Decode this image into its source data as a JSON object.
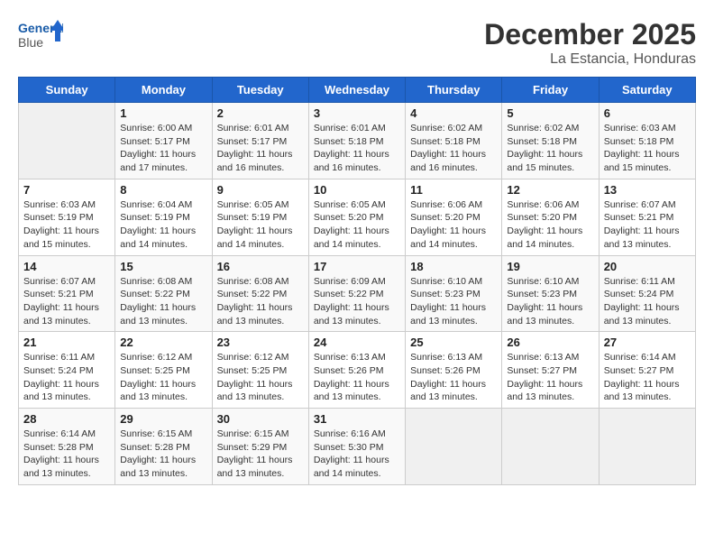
{
  "logo": {
    "name_part1": "General",
    "name_part2": "Blue"
  },
  "title": "December 2025",
  "location": "La Estancia, Honduras",
  "days_of_week": [
    "Sunday",
    "Monday",
    "Tuesday",
    "Wednesday",
    "Thursday",
    "Friday",
    "Saturday"
  ],
  "weeks": [
    [
      {
        "day": "",
        "empty": true
      },
      {
        "day": "1",
        "sunrise": "Sunrise: 6:00 AM",
        "sunset": "Sunset: 5:17 PM",
        "daylight": "Daylight: 11 hours and 17 minutes."
      },
      {
        "day": "2",
        "sunrise": "Sunrise: 6:01 AM",
        "sunset": "Sunset: 5:17 PM",
        "daylight": "Daylight: 11 hours and 16 minutes."
      },
      {
        "day": "3",
        "sunrise": "Sunrise: 6:01 AM",
        "sunset": "Sunset: 5:18 PM",
        "daylight": "Daylight: 11 hours and 16 minutes."
      },
      {
        "day": "4",
        "sunrise": "Sunrise: 6:02 AM",
        "sunset": "Sunset: 5:18 PM",
        "daylight": "Daylight: 11 hours and 16 minutes."
      },
      {
        "day": "5",
        "sunrise": "Sunrise: 6:02 AM",
        "sunset": "Sunset: 5:18 PM",
        "daylight": "Daylight: 11 hours and 15 minutes."
      },
      {
        "day": "6",
        "sunrise": "Sunrise: 6:03 AM",
        "sunset": "Sunset: 5:18 PM",
        "daylight": "Daylight: 11 hours and 15 minutes."
      }
    ],
    [
      {
        "day": "7",
        "sunrise": "Sunrise: 6:03 AM",
        "sunset": "Sunset: 5:19 PM",
        "daylight": "Daylight: 11 hours and 15 minutes."
      },
      {
        "day": "8",
        "sunrise": "Sunrise: 6:04 AM",
        "sunset": "Sunset: 5:19 PM",
        "daylight": "Daylight: 11 hours and 14 minutes."
      },
      {
        "day": "9",
        "sunrise": "Sunrise: 6:05 AM",
        "sunset": "Sunset: 5:19 PM",
        "daylight": "Daylight: 11 hours and 14 minutes."
      },
      {
        "day": "10",
        "sunrise": "Sunrise: 6:05 AM",
        "sunset": "Sunset: 5:20 PM",
        "daylight": "Daylight: 11 hours and 14 minutes."
      },
      {
        "day": "11",
        "sunrise": "Sunrise: 6:06 AM",
        "sunset": "Sunset: 5:20 PM",
        "daylight": "Daylight: 11 hours and 14 minutes."
      },
      {
        "day": "12",
        "sunrise": "Sunrise: 6:06 AM",
        "sunset": "Sunset: 5:20 PM",
        "daylight": "Daylight: 11 hours and 14 minutes."
      },
      {
        "day": "13",
        "sunrise": "Sunrise: 6:07 AM",
        "sunset": "Sunset: 5:21 PM",
        "daylight": "Daylight: 11 hours and 13 minutes."
      }
    ],
    [
      {
        "day": "14",
        "sunrise": "Sunrise: 6:07 AM",
        "sunset": "Sunset: 5:21 PM",
        "daylight": "Daylight: 11 hours and 13 minutes."
      },
      {
        "day": "15",
        "sunrise": "Sunrise: 6:08 AM",
        "sunset": "Sunset: 5:22 PM",
        "daylight": "Daylight: 11 hours and 13 minutes."
      },
      {
        "day": "16",
        "sunrise": "Sunrise: 6:08 AM",
        "sunset": "Sunset: 5:22 PM",
        "daylight": "Daylight: 11 hours and 13 minutes."
      },
      {
        "day": "17",
        "sunrise": "Sunrise: 6:09 AM",
        "sunset": "Sunset: 5:22 PM",
        "daylight": "Daylight: 11 hours and 13 minutes."
      },
      {
        "day": "18",
        "sunrise": "Sunrise: 6:10 AM",
        "sunset": "Sunset: 5:23 PM",
        "daylight": "Daylight: 11 hours and 13 minutes."
      },
      {
        "day": "19",
        "sunrise": "Sunrise: 6:10 AM",
        "sunset": "Sunset: 5:23 PM",
        "daylight": "Daylight: 11 hours and 13 minutes."
      },
      {
        "day": "20",
        "sunrise": "Sunrise: 6:11 AM",
        "sunset": "Sunset: 5:24 PM",
        "daylight": "Daylight: 11 hours and 13 minutes."
      }
    ],
    [
      {
        "day": "21",
        "sunrise": "Sunrise: 6:11 AM",
        "sunset": "Sunset: 5:24 PM",
        "daylight": "Daylight: 11 hours and 13 minutes."
      },
      {
        "day": "22",
        "sunrise": "Sunrise: 6:12 AM",
        "sunset": "Sunset: 5:25 PM",
        "daylight": "Daylight: 11 hours and 13 minutes."
      },
      {
        "day": "23",
        "sunrise": "Sunrise: 6:12 AM",
        "sunset": "Sunset: 5:25 PM",
        "daylight": "Daylight: 11 hours and 13 minutes."
      },
      {
        "day": "24",
        "sunrise": "Sunrise: 6:13 AM",
        "sunset": "Sunset: 5:26 PM",
        "daylight": "Daylight: 11 hours and 13 minutes."
      },
      {
        "day": "25",
        "sunrise": "Sunrise: 6:13 AM",
        "sunset": "Sunset: 5:26 PM",
        "daylight": "Daylight: 11 hours and 13 minutes."
      },
      {
        "day": "26",
        "sunrise": "Sunrise: 6:13 AM",
        "sunset": "Sunset: 5:27 PM",
        "daylight": "Daylight: 11 hours and 13 minutes."
      },
      {
        "day": "27",
        "sunrise": "Sunrise: 6:14 AM",
        "sunset": "Sunset: 5:27 PM",
        "daylight": "Daylight: 11 hours and 13 minutes."
      }
    ],
    [
      {
        "day": "28",
        "sunrise": "Sunrise: 6:14 AM",
        "sunset": "Sunset: 5:28 PM",
        "daylight": "Daylight: 11 hours and 13 minutes."
      },
      {
        "day": "29",
        "sunrise": "Sunrise: 6:15 AM",
        "sunset": "Sunset: 5:28 PM",
        "daylight": "Daylight: 11 hours and 13 minutes."
      },
      {
        "day": "30",
        "sunrise": "Sunrise: 6:15 AM",
        "sunset": "Sunset: 5:29 PM",
        "daylight": "Daylight: 11 hours and 13 minutes."
      },
      {
        "day": "31",
        "sunrise": "Sunrise: 6:16 AM",
        "sunset": "Sunset: 5:30 PM",
        "daylight": "Daylight: 11 hours and 14 minutes."
      },
      {
        "day": "",
        "empty": true
      },
      {
        "day": "",
        "empty": true
      },
      {
        "day": "",
        "empty": true
      }
    ]
  ]
}
